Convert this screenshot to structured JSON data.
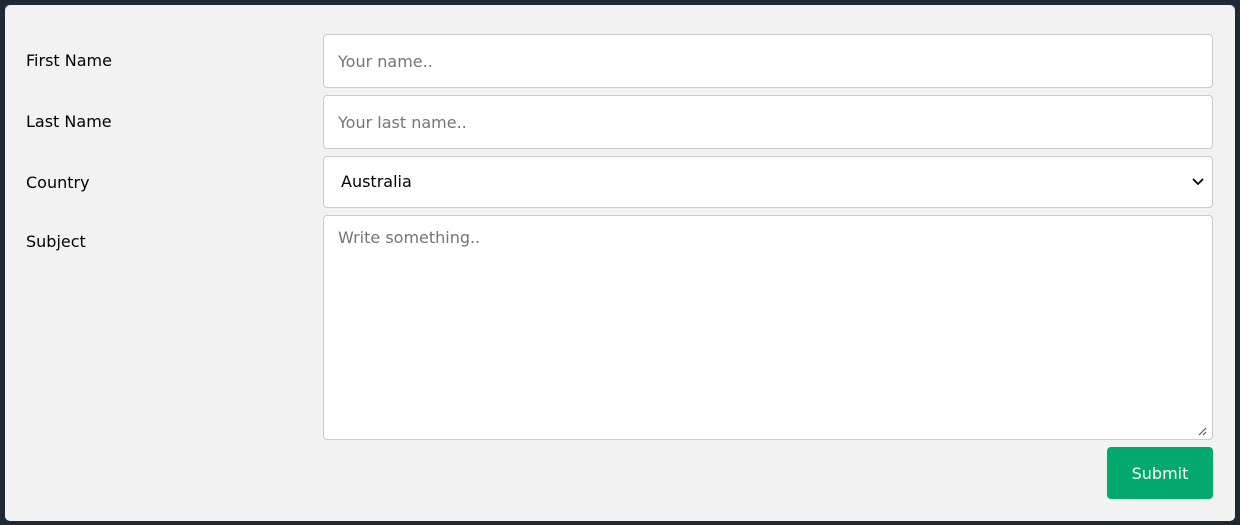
{
  "form": {
    "first_name": {
      "label": "First Name",
      "placeholder": "Your name..",
      "value": ""
    },
    "last_name": {
      "label": "Last Name",
      "placeholder": "Your last name..",
      "value": ""
    },
    "country": {
      "label": "Country",
      "selected": "Australia"
    },
    "subject": {
      "label": "Subject",
      "placeholder": "Write something..",
      "value": ""
    },
    "submit_label": "Submit"
  },
  "colors": {
    "background": "#1d2a35",
    "panel": "#f2f2f2",
    "submit": "#04aa6d",
    "border": "#cccccc"
  },
  "icons": {
    "select_arrow": "chevron-down-icon",
    "textarea_resize": "resize-grip-icon"
  }
}
